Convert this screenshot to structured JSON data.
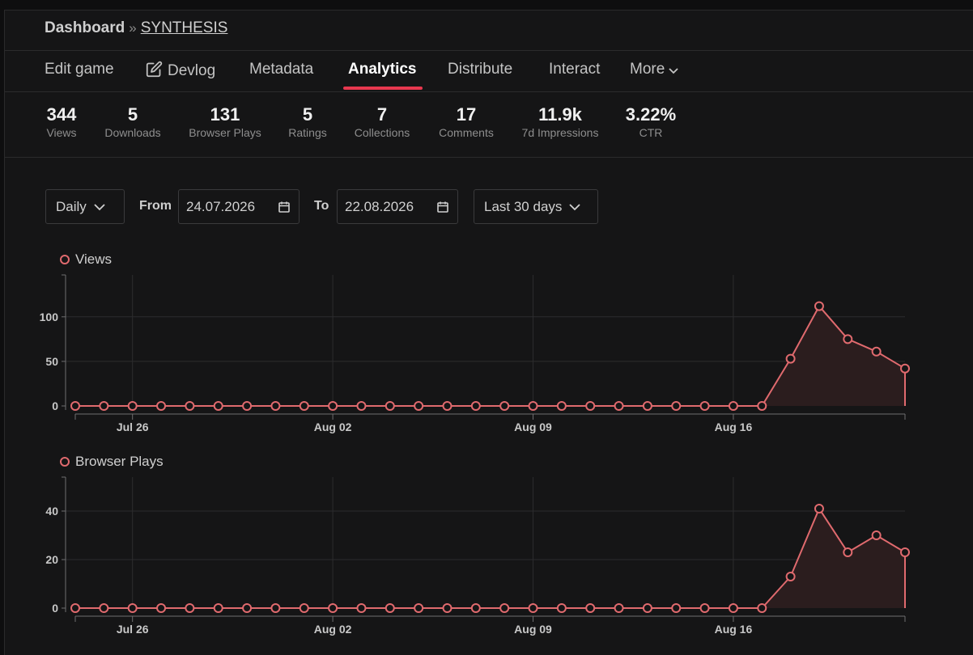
{
  "breadcrumb": {
    "home": "Dashboard",
    "separator": "»",
    "game": "SYNTHESIS"
  },
  "tabs": {
    "edit": "Edit game",
    "devlog": "Devlog",
    "metadata": "Metadata",
    "analytics": "Analytics",
    "distribute": "Distribute",
    "interact": "Interact",
    "more": "More",
    "active": "Analytics"
  },
  "stats": [
    {
      "value": "344",
      "label": "Views"
    },
    {
      "value": "5",
      "label": "Downloads"
    },
    {
      "value": "131",
      "label": "Browser Plays"
    },
    {
      "value": "5",
      "label": "Ratings"
    },
    {
      "value": "7",
      "label": "Collections"
    },
    {
      "value": "17",
      "label": "Comments"
    },
    {
      "value": "11.9k",
      "label": "7d Impressions"
    },
    {
      "value": "3.22%",
      "label": "CTR"
    }
  ],
  "controls": {
    "interval": "Daily",
    "from_label": "From",
    "from_value": "24.07.2026",
    "to_label": "To",
    "to_value": "22.08.2026",
    "range": "Last 30 days"
  },
  "colors": {
    "accent": "#e8384f",
    "series": "#e06a6e",
    "fill": "#2b1d1e",
    "background": "#151516"
  },
  "icons": {
    "devlog": "edit-icon",
    "dropdown": "chevron-down-icon",
    "calendar": "calendar-icon"
  },
  "chart_data": [
    {
      "type": "area",
      "title": "",
      "series": [
        {
          "name": "Views",
          "values": [
            0,
            0,
            0,
            0,
            0,
            0,
            0,
            0,
            0,
            0,
            0,
            0,
            0,
            0,
            0,
            0,
            0,
            0,
            0,
            0,
            0,
            0,
            0,
            0,
            0,
            53,
            112,
            75,
            61,
            42
          ]
        }
      ],
      "x": [
        "Jul 24",
        "Jul 25",
        "Jul 26",
        "Jul 27",
        "Jul 28",
        "Jul 29",
        "Jul 30",
        "Jul 31",
        "Aug 01",
        "Aug 02",
        "Aug 03",
        "Aug 04",
        "Aug 05",
        "Aug 06",
        "Aug 07",
        "Aug 08",
        "Aug 09",
        "Aug 10",
        "Aug 11",
        "Aug 12",
        "Aug 13",
        "Aug 14",
        "Aug 15",
        "Aug 16",
        "Aug 17",
        "Aug 18",
        "Aug 19",
        "Aug 20",
        "Aug 21",
        "Aug 22"
      ],
      "x_ticks": [
        "Jul 26",
        "Aug 02",
        "Aug 09",
        "Aug 16"
      ],
      "y_ticks": [
        0,
        50,
        100
      ],
      "ylim": [
        0,
        147
      ],
      "grid": true,
      "legend": "top-left"
    },
    {
      "type": "area",
      "title": "",
      "series": [
        {
          "name": "Browser Plays",
          "values": [
            0,
            0,
            0,
            0,
            0,
            0,
            0,
            0,
            0,
            0,
            0,
            0,
            0,
            0,
            0,
            0,
            0,
            0,
            0,
            0,
            0,
            0,
            0,
            0,
            0,
            13,
            41,
            23,
            30,
            23
          ]
        }
      ],
      "x": [
        "Jul 24",
        "Jul 25",
        "Jul 26",
        "Jul 27",
        "Jul 28",
        "Jul 29",
        "Jul 30",
        "Jul 31",
        "Aug 01",
        "Aug 02",
        "Aug 03",
        "Aug 04",
        "Aug 05",
        "Aug 06",
        "Aug 07",
        "Aug 08",
        "Aug 09",
        "Aug 10",
        "Aug 11",
        "Aug 12",
        "Aug 13",
        "Aug 14",
        "Aug 15",
        "Aug 16",
        "Aug 17",
        "Aug 18",
        "Aug 19",
        "Aug 20",
        "Aug 21",
        "Aug 22"
      ],
      "x_ticks": [
        "Jul 26",
        "Aug 02",
        "Aug 09",
        "Aug 16"
      ],
      "y_ticks": [
        0,
        20,
        40
      ],
      "ylim": [
        0,
        54
      ],
      "grid": true,
      "legend": "top-left"
    }
  ]
}
